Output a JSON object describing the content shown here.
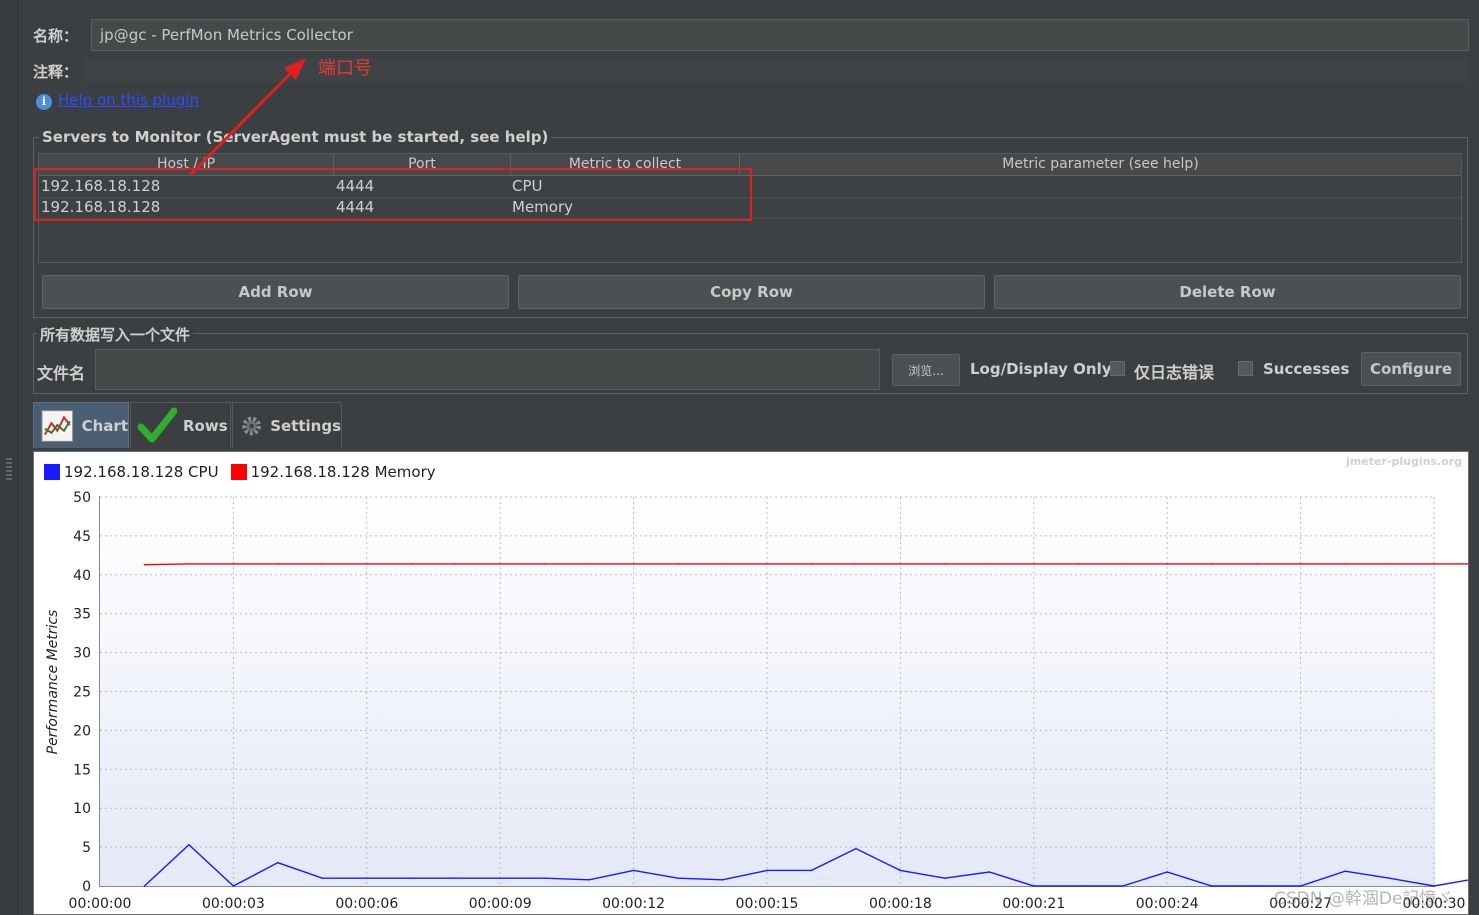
{
  "header": {
    "name_label": "名称：",
    "name_value": "jp@gc - PerfMon Metrics Collector",
    "comment_label": "注释：",
    "help_link": "Help on this plugin"
  },
  "annotation": {
    "port_note": "端口号",
    "color": "#e53935"
  },
  "servers": {
    "title": "Servers to Monitor (ServerAgent must be started, see help)",
    "columns": [
      "Host / IP",
      "Port",
      "Metric to collect",
      "Metric parameter (see help)"
    ],
    "rows": [
      {
        "host": "192.168.18.128",
        "port": "4444",
        "metric": "CPU",
        "param": ""
      },
      {
        "host": "192.168.18.128",
        "port": "4444",
        "metric": "Memory",
        "param": ""
      }
    ],
    "add_row": "Add Row",
    "copy_row": "Copy Row",
    "delete_row": "Delete Row"
  },
  "file_section": {
    "title": "所有数据写入一个文件",
    "filename_label": "文件名",
    "filename_value": "",
    "browse": "浏览...",
    "log_display_label": "Log/Display Only:",
    "errors_only": "仅日志错误",
    "successes": "Successes",
    "configure": "Configure"
  },
  "tabs": [
    {
      "label": "Chart",
      "icon": "chart-icon",
      "selected": true
    },
    {
      "label": "Rows",
      "icon": "checkmark-icon",
      "selected": false
    },
    {
      "label": "Settings",
      "icon": "gear-icon",
      "selected": false
    }
  ],
  "watermark": "jmeter-plugins.org",
  "csdn_watermark": "CSDN @幹涸De記憶ゞ",
  "chart_data": {
    "type": "line",
    "ylabel": "Performance Metrics",
    "xlabel": "",
    "ylim": [
      0,
      50
    ],
    "yticks": [
      0,
      5,
      10,
      15,
      20,
      25,
      30,
      35,
      40,
      45,
      50
    ],
    "xticks": [
      "00:00:00",
      "00:00:03",
      "00:00:06",
      "00:00:09",
      "00:00:12",
      "00:00:15",
      "00:00:18",
      "00:00:21",
      "00:00:24",
      "00:00:27",
      "00:00:30"
    ],
    "x_seconds": [
      1,
      2,
      3,
      4,
      5,
      6,
      7,
      8,
      9,
      10,
      11,
      12,
      13,
      14,
      15,
      16,
      17,
      18,
      19,
      20,
      21,
      22,
      23,
      24,
      25,
      26,
      27,
      28,
      29,
      30
    ],
    "legend_position": "top-left",
    "grid": true,
    "series": [
      {
        "name": "192.168.18.128 CPU",
        "color": "#1a1aff",
        "values": [
          0,
          5.3,
          0,
          3,
          1,
          1,
          1,
          1,
          1,
          1,
          0.8,
          2,
          1,
          0.8,
          2,
          2,
          4.8,
          2,
          1,
          1.8,
          0,
          0,
          0,
          1.8,
          0,
          0,
          0,
          1.9,
          1,
          0,
          1
        ]
      },
      {
        "name": "192.168.18.128 Memory",
        "color": "#ff0000",
        "values": [
          41.3,
          41.4,
          41.4,
          41.4,
          41.4,
          41.4,
          41.4,
          41.4,
          41.4,
          41.4,
          41.4,
          41.4,
          41.4,
          41.4,
          41.4,
          41.4,
          41.4,
          41.4,
          41.4,
          41.4,
          41.4,
          41.4,
          41.4,
          41.4,
          41.4,
          41.4,
          41.4,
          41.4,
          41.4,
          41.4,
          41.4
        ]
      }
    ]
  }
}
